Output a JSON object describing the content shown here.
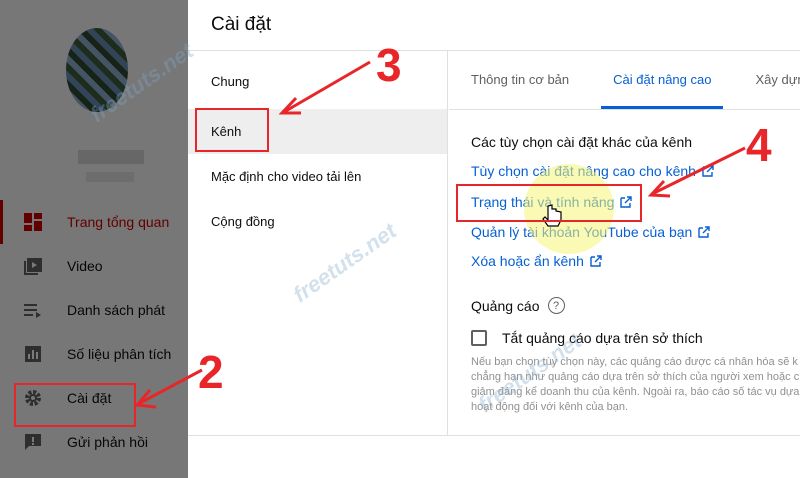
{
  "sidebar": {
    "items": [
      {
        "label": "Trang tổng quan",
        "icon": "dashboard-icon",
        "active": true
      },
      {
        "label": "Video",
        "icon": "video-icon"
      },
      {
        "label": "Danh sách phát",
        "icon": "playlist-icon"
      },
      {
        "label": "Số liệu phân tích",
        "icon": "analytics-icon"
      },
      {
        "label": "Cài đặt",
        "icon": "gear-icon"
      },
      {
        "label": "Gửi phản hồi",
        "icon": "feedback-icon"
      }
    ]
  },
  "dialog": {
    "title": "Cài đặt",
    "nav": [
      {
        "label": "Chung"
      },
      {
        "label": "Kênh",
        "selected": true
      },
      {
        "label": "Mặc định cho video tải lên"
      },
      {
        "label": "Cộng đồng"
      }
    ],
    "tabs": [
      {
        "label": "Thông tin cơ bản"
      },
      {
        "label": "Cài đặt nâng cao",
        "active": true
      },
      {
        "label": "Xây dựng"
      }
    ],
    "section_title": "Các tùy chọn cài đặt khác của kênh",
    "links": [
      {
        "label": "Tùy chọn cài đặt nâng cao cho kênh"
      },
      {
        "label": "Trạng thái và tính năng"
      },
      {
        "label": "Quản lý tài khoản YouTube của bạn"
      },
      {
        "label": "Xóa hoặc ẩn kênh"
      }
    ],
    "ads": {
      "title": "Quảng cáo",
      "help": "?",
      "checkbox_label": "Tắt quảng cáo dựa trên sở thích",
      "description": [
        "Nếu bạn chọn tùy chọn này, các quảng cáo được cá nhân hóa sẽ k",
        "chẳng hạn như quảng cáo dựa trên sở thích của người xem hoặc c",
        "giảm đáng kể doanh thu của kênh. Ngoài ra, báo cáo số tác vụ dựa",
        "hoạt động đối với kênh của bạn."
      ]
    }
  },
  "annotations": {
    "step2": "2",
    "step3": "3",
    "step4": "4",
    "color": "#e8262a"
  },
  "watermark": "freetuts.net",
  "colors": {
    "accent": "#065fd4",
    "youtube_red": "#cc0000"
  }
}
